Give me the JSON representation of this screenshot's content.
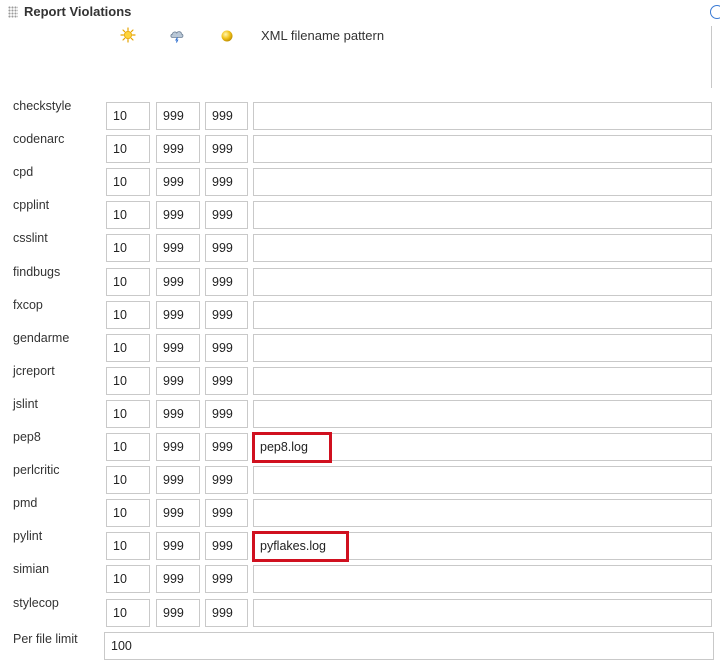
{
  "section": {
    "title": "Report Violations"
  },
  "columns": {
    "sunny_icon": "sun-icon",
    "stormy_icon": "storm-cloud-icon",
    "unstable_icon": "yellow-ball-icon",
    "pattern_header": "XML filename pattern"
  },
  "colors": {
    "highlight": "#d0101f",
    "help_icon": "#3a7bd5"
  },
  "violations": [
    {
      "name": "checkstyle",
      "sunny": "10",
      "stormy": "999",
      "unstable": "999",
      "pattern": ""
    },
    {
      "name": "codenarc",
      "sunny": "10",
      "stormy": "999",
      "unstable": "999",
      "pattern": ""
    },
    {
      "name": "cpd",
      "sunny": "10",
      "stormy": "999",
      "unstable": "999",
      "pattern": ""
    },
    {
      "name": "cpplint",
      "sunny": "10",
      "stormy": "999",
      "unstable": "999",
      "pattern": ""
    },
    {
      "name": "csslint",
      "sunny": "10",
      "stormy": "999",
      "unstable": "999",
      "pattern": ""
    },
    {
      "name": "findbugs",
      "sunny": "10",
      "stormy": "999",
      "unstable": "999",
      "pattern": ""
    },
    {
      "name": "fxcop",
      "sunny": "10",
      "stormy": "999",
      "unstable": "999",
      "pattern": ""
    },
    {
      "name": "gendarme",
      "sunny": "10",
      "stormy": "999",
      "unstable": "999",
      "pattern": ""
    },
    {
      "name": "jcreport",
      "sunny": "10",
      "stormy": "999",
      "unstable": "999",
      "pattern": ""
    },
    {
      "name": "jslint",
      "sunny": "10",
      "stormy": "999",
      "unstable": "999",
      "pattern": ""
    },
    {
      "name": "pep8",
      "sunny": "10",
      "stormy": "999",
      "unstable": "999",
      "pattern": "pep8.log"
    },
    {
      "name": "perlcritic",
      "sunny": "10",
      "stormy": "999",
      "unstable": "999",
      "pattern": ""
    },
    {
      "name": "pmd",
      "sunny": "10",
      "stormy": "999",
      "unstable": "999",
      "pattern": ""
    },
    {
      "name": "pylint",
      "sunny": "10",
      "stormy": "999",
      "unstable": "999",
      "pattern": "pyflakes.log"
    },
    {
      "name": "simian",
      "sunny": "10",
      "stormy": "999",
      "unstable": "999",
      "pattern": ""
    },
    {
      "name": "stylecop",
      "sunny": "10",
      "stormy": "999",
      "unstable": "999",
      "pattern": ""
    }
  ],
  "per_file_limit": {
    "label": "Per file limit",
    "value": "100"
  }
}
